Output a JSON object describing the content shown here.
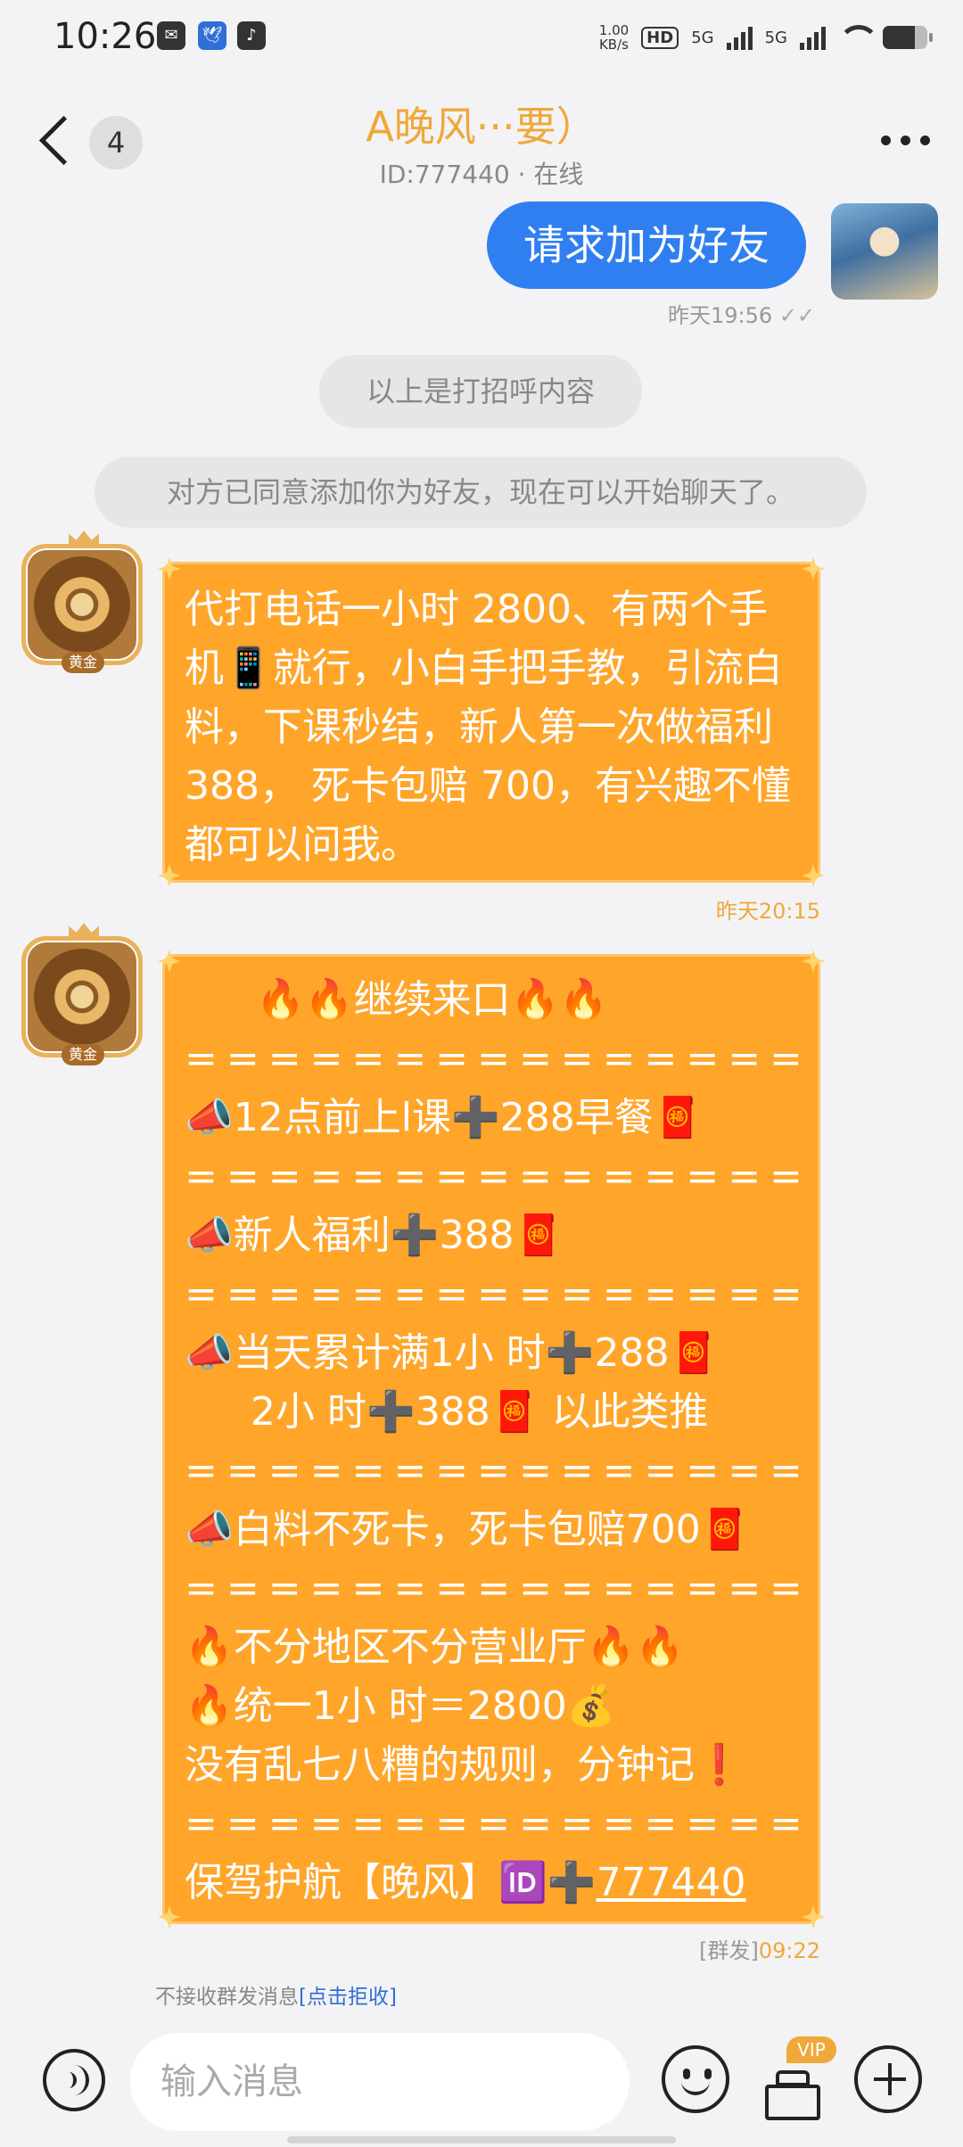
{
  "status_bar": {
    "time": "10:26",
    "net_speed": "1.00",
    "net_unit": "KB/s",
    "hd_label": "HD",
    "sim1": "5G",
    "sim2": "5G",
    "app_icons": [
      "mail-icon",
      "bird-icon",
      "tiktok-icon"
    ]
  },
  "header": {
    "unread_count": "4",
    "title": "A晚风···要）",
    "subtitle": "ID:777440 · 在线"
  },
  "messages": {
    "outgoing": {
      "text": "请求加为好友",
      "time": "昨天19:56"
    },
    "system_1": "以上是打招呼内容",
    "system_2": "对方已同意添加你为好友，现在可以开始聊天了。",
    "msg1": {
      "avatar_tag": "黄金",
      "text": "代打电话一小时 2800、有两个手机📱就行，小白手把手教，引流白料，下课秒结，新人第一次做福利 388， 死卡包赔 700，有兴趣不懂都可以问我。",
      "time": "昨天20:15"
    },
    "msg2": {
      "avatar_tag": "黄金",
      "lines": {
        "l1": "🔥🔥继续来口🔥🔥",
        "sep": "================",
        "l2": "📣12点前上l课➕288早餐🧧",
        "l3": "📣新人福利➕388🧧",
        "l4": "📣当天累计满1小 时➕288🧧",
        "l5": "2小 时➕388🧧 以此类推",
        "l6": "📣白料不死卡，死卡包赔700🧧",
        "l7": "🔥不分地区不分营业厅🔥🔥",
        "l8": "🔥统一1小 时＝2800💰",
        "l9": "没有乱七八糟的规则，分钟记❗",
        "l10_prefix": "保驾护航【晚风】🆔➕",
        "l10_id": "777440"
      },
      "group_tag": "[群发]",
      "time": "09:22"
    },
    "notice_text": "不接收群发消息",
    "notice_link": "[点击拒收]"
  },
  "input_bar": {
    "placeholder": "输入消息",
    "vip_badge": "VIP"
  },
  "colors": {
    "accent_orange": "#ffa52a",
    "title_gold": "#f0a83a",
    "outgoing_blue": "#2f7ff0"
  }
}
